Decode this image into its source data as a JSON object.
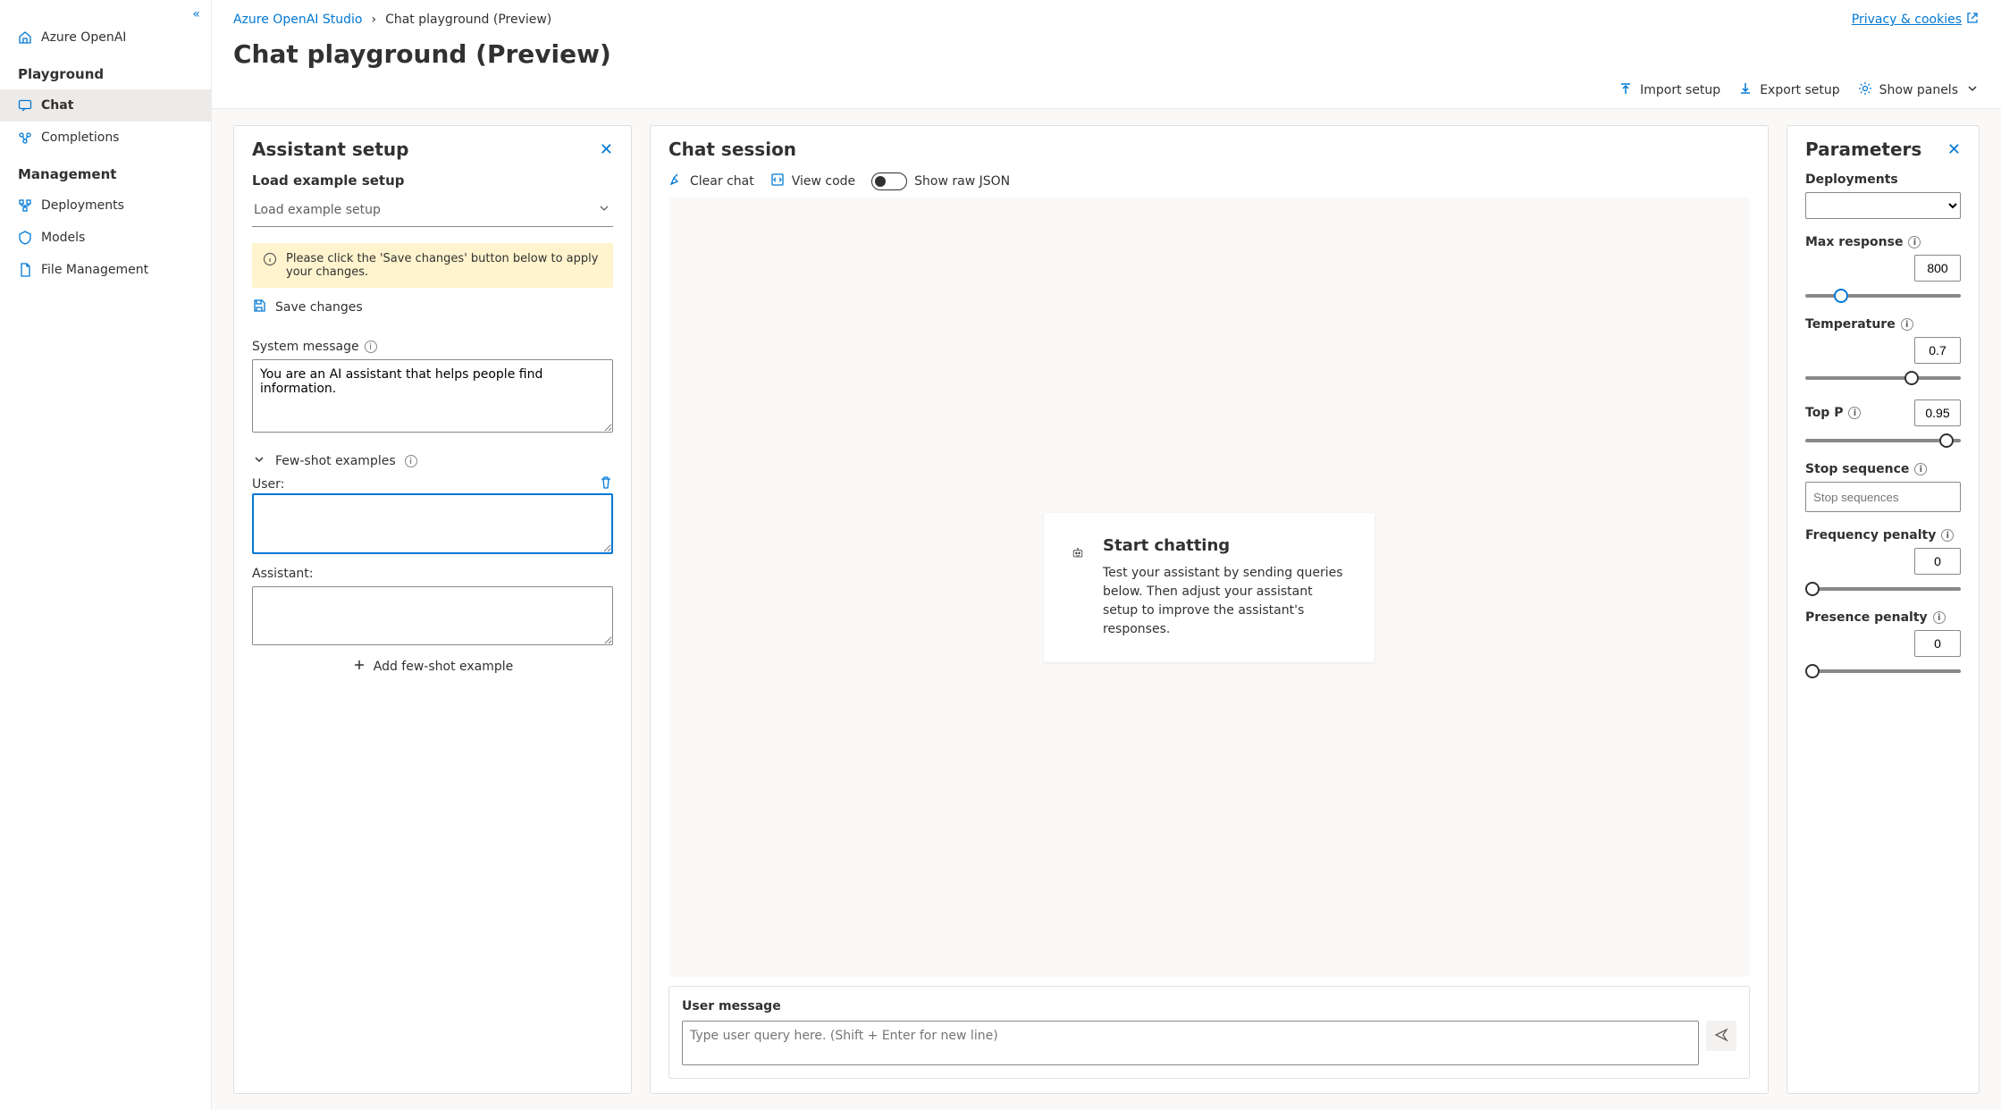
{
  "sidebar": {
    "collapse_glyph": "«",
    "home": "Azure OpenAI",
    "section_playground": "Playground",
    "item_chat": "Chat",
    "item_completions": "Completions",
    "section_management": "Management",
    "item_deployments": "Deployments",
    "item_models": "Models",
    "item_files": "File Management"
  },
  "breadcrumb": {
    "root": "Azure OpenAI Studio",
    "sep": "›",
    "current": "Chat playground (Preview)",
    "privacy": "Privacy & cookies"
  },
  "page": {
    "title": "Chat playground (Preview)"
  },
  "toolbar": {
    "import": "Import setup",
    "export": "Export setup",
    "show_panels": "Show panels"
  },
  "setup": {
    "title": "Assistant setup",
    "load_label": "Load example setup",
    "load_placeholder": "Load example setup",
    "banner": "Please click the 'Save changes' button below to apply your changes.",
    "save": "Save changes",
    "system_label": "System message",
    "system_value": "You are an AI assistant that helps people find information.",
    "fewshot_label": "Few-shot examples",
    "user_label": "User:",
    "user_value": "",
    "assistant_label": "Assistant:",
    "assistant_value": "",
    "add_example": "Add few-shot example"
  },
  "chat": {
    "title": "Chat session",
    "clear": "Clear chat",
    "view_code": "View code",
    "show_raw": "Show raw JSON",
    "start_title": "Start chatting",
    "start_body": "Test your assistant by sending queries below. Then adjust your assistant setup to improve the assistant's responses.",
    "user_msg_label": "User message",
    "user_msg_placeholder": "Type user query here. (Shift + Enter for new line)"
  },
  "params": {
    "title": "Parameters",
    "deployments_label": "Deployments",
    "max_response_label": "Max response",
    "max_response_value": "800",
    "temperature_label": "Temperature",
    "temperature_value": "0.7",
    "top_p_label": "Top P",
    "top_p_value": "0.95",
    "stop_label": "Stop sequence",
    "stop_placeholder": "Stop sequences",
    "freq_label": "Frequency penalty",
    "freq_value": "0",
    "pres_label": "Presence penalty",
    "pres_value": "0"
  }
}
